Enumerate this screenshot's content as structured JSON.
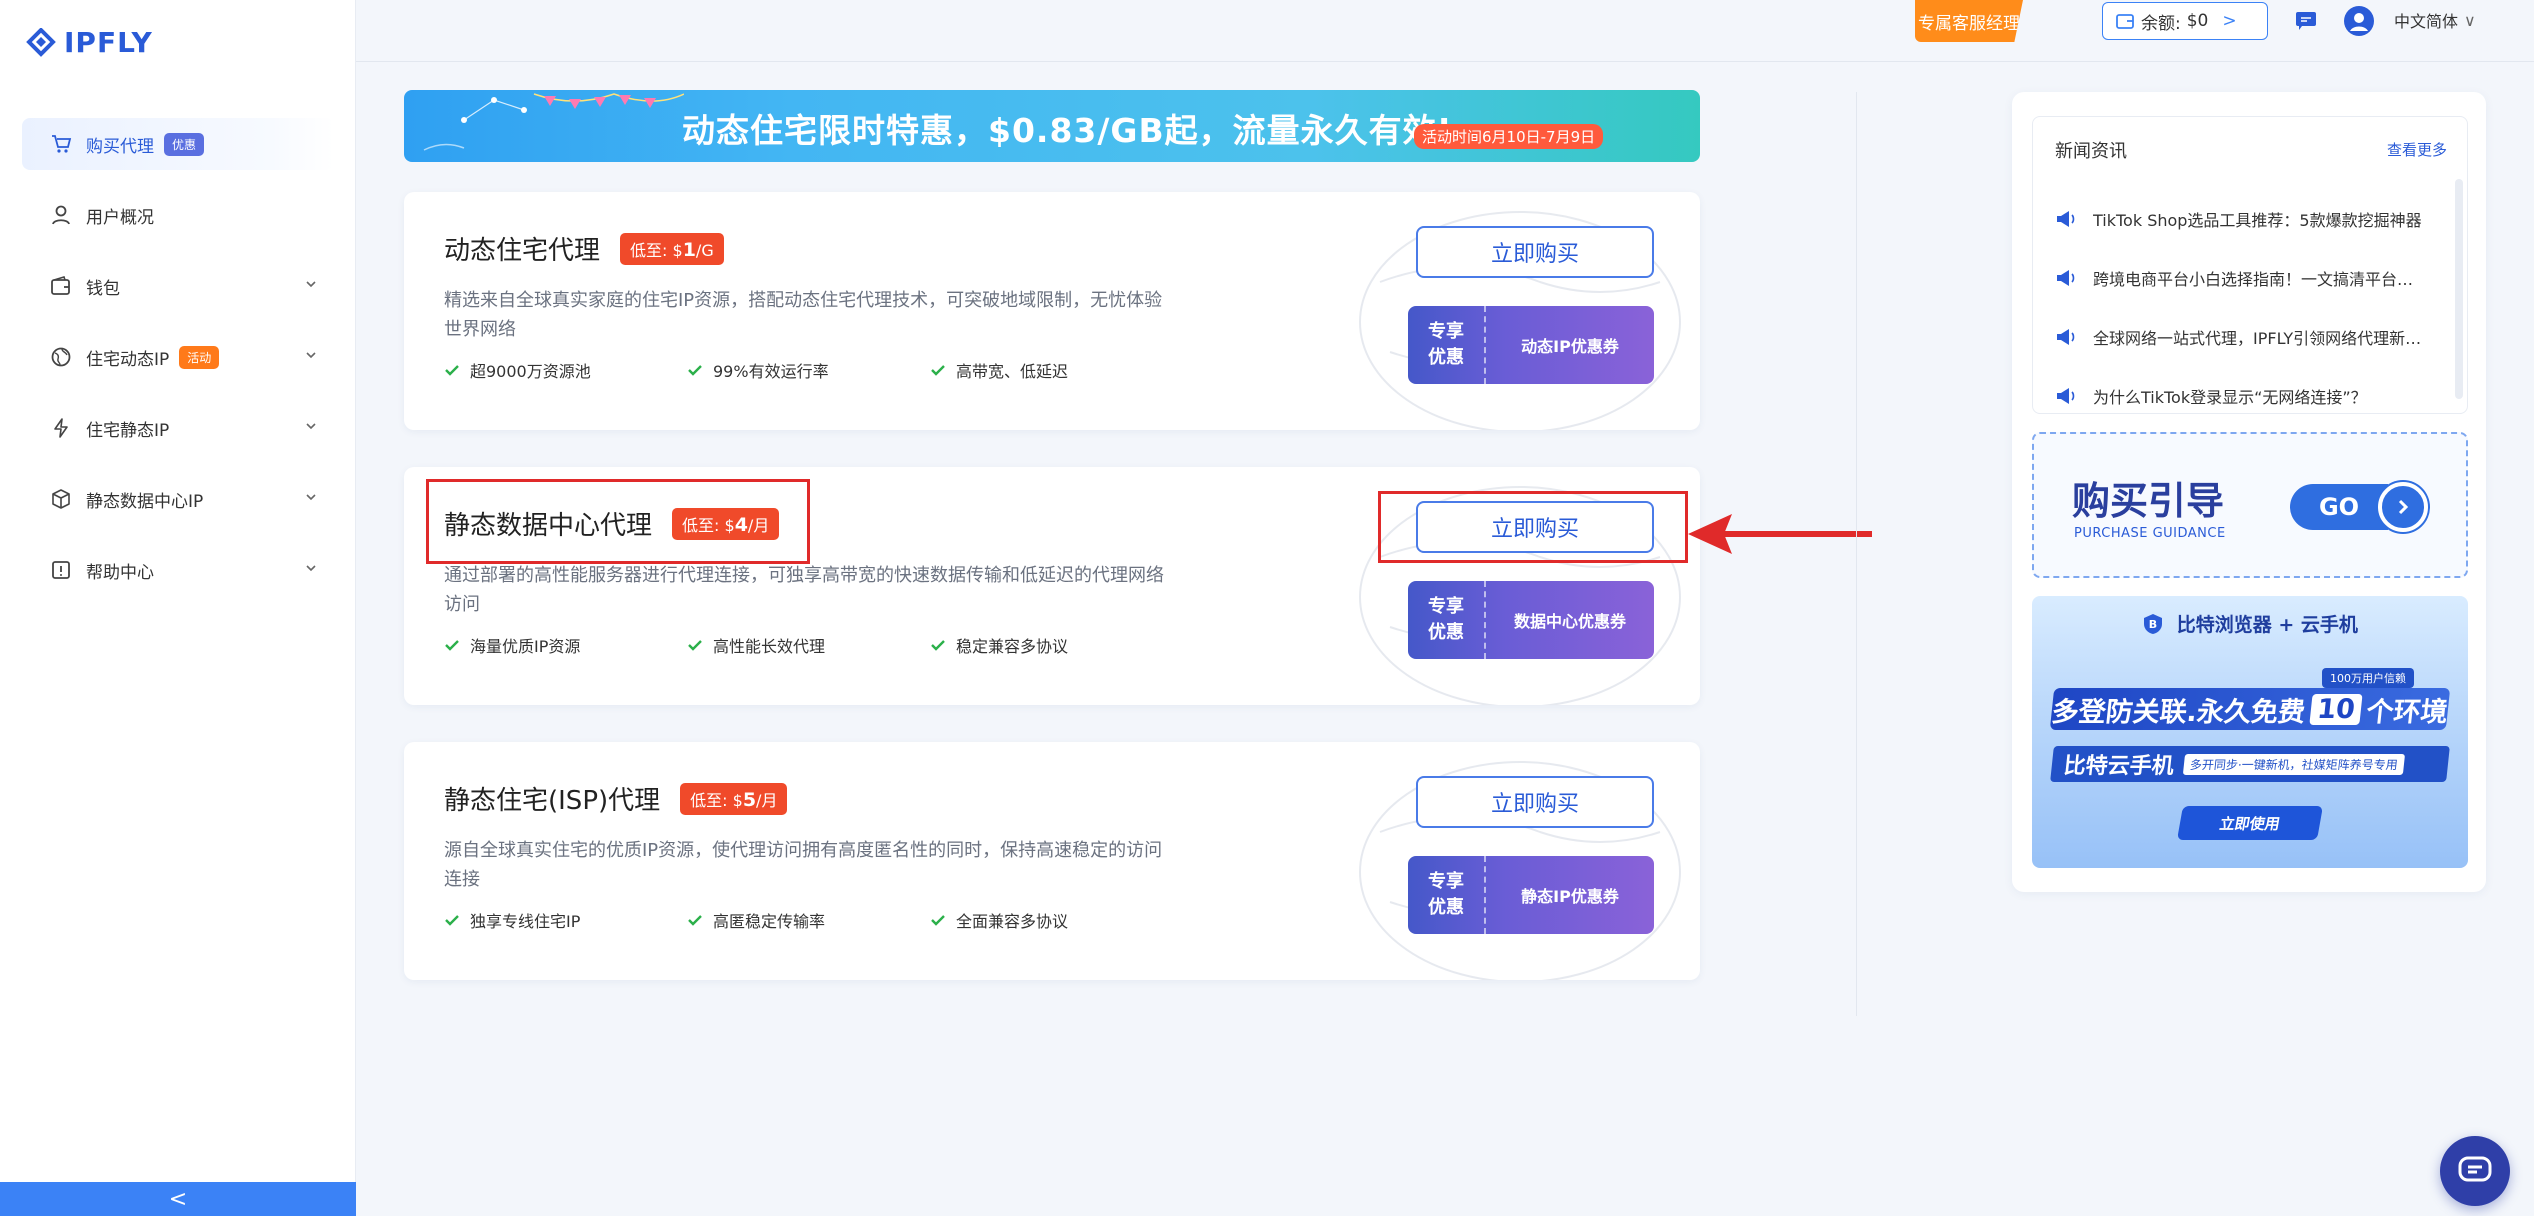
{
  "brand": {
    "name": "IPFLY"
  },
  "sidebar": {
    "items": [
      {
        "label": "购买代理",
        "badge": "优惠",
        "active": true,
        "icon": "cart-icon"
      },
      {
        "label": "用户概况",
        "icon": "user-icon"
      },
      {
        "label": "钱包",
        "icon": "wallet-icon",
        "expandable": true
      },
      {
        "label": "住宅动态IP",
        "badge": "活动",
        "icon": "globe-icon",
        "expandable": true
      },
      {
        "label": "住宅静态IP",
        "icon": "bolt-icon",
        "expandable": true
      },
      {
        "label": "静态数据中心IP",
        "icon": "cube-icon",
        "expandable": true
      },
      {
        "label": "帮助中心",
        "icon": "help-book-icon",
        "expandable": true
      }
    ],
    "collapse_glyph": "<"
  },
  "topbar": {
    "manager": "专属客服经理",
    "balance_label": "余额:",
    "balance_value": "$0",
    "balance_arrow": ">",
    "language": "中文简体",
    "language_caret": "∨"
  },
  "banner": {
    "title": "动态住宅限时特惠，$0.83/GB起，流量永久有效!",
    "date": "活动时间6月10日-7月9日"
  },
  "products": [
    {
      "title": "动态住宅代理",
      "price_prefix": "低至: $",
      "price": "1",
      "price_unit": "/G",
      "desc": "精选来自全球真实家庭的住宅IP资源，搭配动态住宅代理技术，可突破地域限制，无忧体验世界网络",
      "features": [
        "超9000万资源池",
        "99%有效运行率",
        "高带宽、低延迟"
      ],
      "buy_label": "立即购买",
      "coupon_left": [
        "专享",
        "优惠"
      ],
      "coupon_right": "动态IP优惠券"
    },
    {
      "title": "静态数据中心代理",
      "price_prefix": "低至: $",
      "price": "4",
      "price_unit": "/月",
      "desc": "通过部署的高性能服务器进行代理连接，可独享高带宽的快速数据传输和低延迟的代理网络访问",
      "features": [
        "海量优质IP资源",
        "高性能长效代理",
        "稳定兼容多协议"
      ],
      "buy_label": "立即购买",
      "coupon_left": [
        "专享",
        "优惠"
      ],
      "coupon_right": "数据中心优惠券"
    },
    {
      "title": "静态住宅(ISP)代理",
      "price_prefix": "低至: $",
      "price": "5",
      "price_unit": "/月",
      "desc": "源自全球真实住宅的优质IP资源，使代理访问拥有高度匿名性的同时，保持高速稳定的访问连接",
      "features": [
        "独享专线住宅IP",
        "高匿稳定传输率",
        "全面兼容多协议"
      ],
      "buy_label": "立即购买",
      "coupon_left": [
        "专享",
        "优惠"
      ],
      "coupon_right": "静态IP优惠券"
    }
  ],
  "news": {
    "title": "新闻资讯",
    "more": "查看更多",
    "items": [
      "TikTok Shop选品工具推荐：5款爆款挖掘神器",
      "跨境电商平台小白选择指南！一文搞清平台…",
      "全球网络一站式代理，IPFLY引领网络代理新…",
      "为什么TikTok登录显示“无网络连接”？"
    ]
  },
  "guide": {
    "title": "购买引导",
    "subtitle": "PURCHASE GUIDANCE",
    "go": "GO"
  },
  "promo": {
    "brand": "比特浏览器 + 云手机",
    "small_tag": "100万用户信赖",
    "main_pre": "多登防关联.永久免费",
    "main_num": "10",
    "main_post": "个环境",
    "second": "比特云手机",
    "second_tag": "多开同步·一键新机，社媒矩阵养号专用",
    "cta": "立即使用"
  },
  "colors": {
    "accent": "#2a5bd7",
    "orange": "#ff8c1a",
    "red_highlight": "#e02a2a",
    "price_badge": "#f04a2a"
  }
}
